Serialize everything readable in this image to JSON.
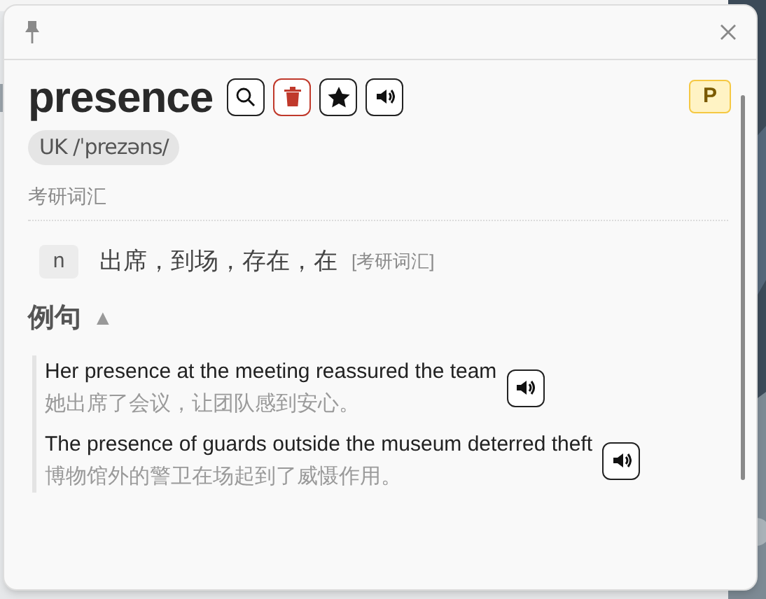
{
  "word": "presence",
  "badge": "P",
  "pronunciation": "UK /ˈprezəns/",
  "tags": "考研词汇",
  "definitions": [
    {
      "pos": "n",
      "meaning": "出席，到场，存在，在",
      "tag": "[考研词汇]"
    }
  ],
  "examples_section": {
    "title": "例句",
    "expanded": true,
    "toggle": "▲"
  },
  "examples": [
    {
      "en": "Her presence at the meeting reassured the team",
      "zh": "她出席了会议，让团队感到安心。"
    },
    {
      "en": "The presence of guards outside the museum deterred theft",
      "zh": "博物馆外的警卫在场起到了威慑作用。"
    }
  ]
}
